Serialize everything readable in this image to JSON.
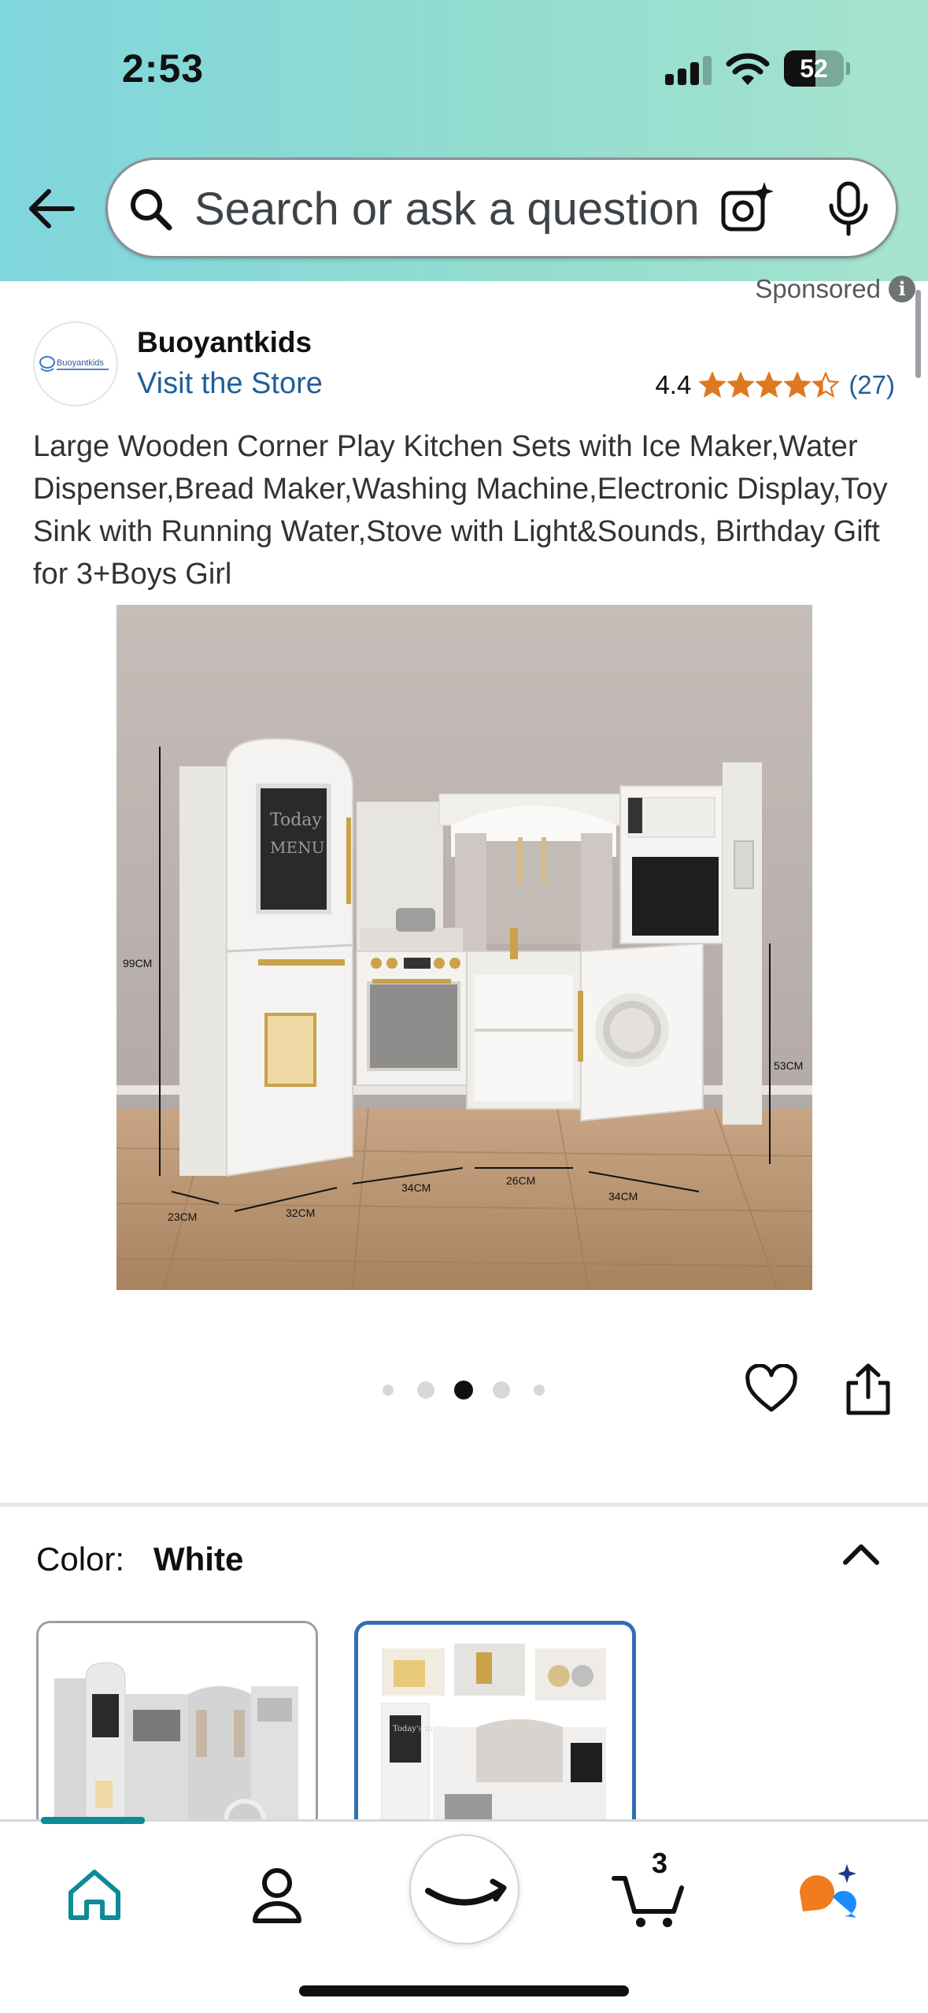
{
  "status_bar": {
    "time": "2:53",
    "battery_percent": "52",
    "battery_level": 0.52
  },
  "search": {
    "placeholder": "Search or ask a question"
  },
  "icons": {
    "back": "back-arrow-icon",
    "search": "search-icon",
    "camera": "camera-lens-icon",
    "mic": "microphone-icon",
    "info": "info-icon",
    "heart": "heart-icon",
    "share": "share-icon",
    "chevron": "chevron-up-icon",
    "home": "home-icon",
    "account": "person-icon",
    "amazon": "amazon-smile-icon",
    "cart": "cart-icon",
    "rufus": "rufus-icon"
  },
  "sponsored": {
    "label": "Sponsored",
    "info_glyph": "i"
  },
  "brand": {
    "logo_text": "Buoyantkids",
    "name": "Buoyantkids",
    "visit_store": "Visit the Store"
  },
  "rating": {
    "value": "4.4",
    "stars": 4.4,
    "max_stars": 5,
    "count": "(27)"
  },
  "product": {
    "title": "Large Wooden Corner Play Kitchen Sets with Ice Maker,Water Dispenser,Bread Maker,Washing Machine,Electronic Display,Toy Sink with Running Water,Stove with Light&Sounds, Birthday Gift for 3+Boys Girl"
  },
  "image_annotations": {
    "height_left": "99CM",
    "height_right": "53CM",
    "depth": "23CM",
    "width_1": "32CM",
    "width_2": "34CM",
    "width_3": "26CM",
    "width_4": "34CM",
    "board_text_1": "Today",
    "board_text_2": "MENU"
  },
  "carousel": {
    "count": 5,
    "active_index": 2
  },
  "color": {
    "label": "Color:",
    "value": "White"
  },
  "swatch_annotations": {
    "board_text": "Today's menu"
  },
  "tabbar": {
    "cart_count": "3",
    "active_tab": "home"
  },
  "colors": {
    "link": "#1f5f9b",
    "star": "#de7921",
    "selected_border": "#2f6eb3",
    "tab_active": "#0f8a96",
    "rufus_orange": "#f07c1e",
    "rufus_blue": "#1a8cff"
  }
}
